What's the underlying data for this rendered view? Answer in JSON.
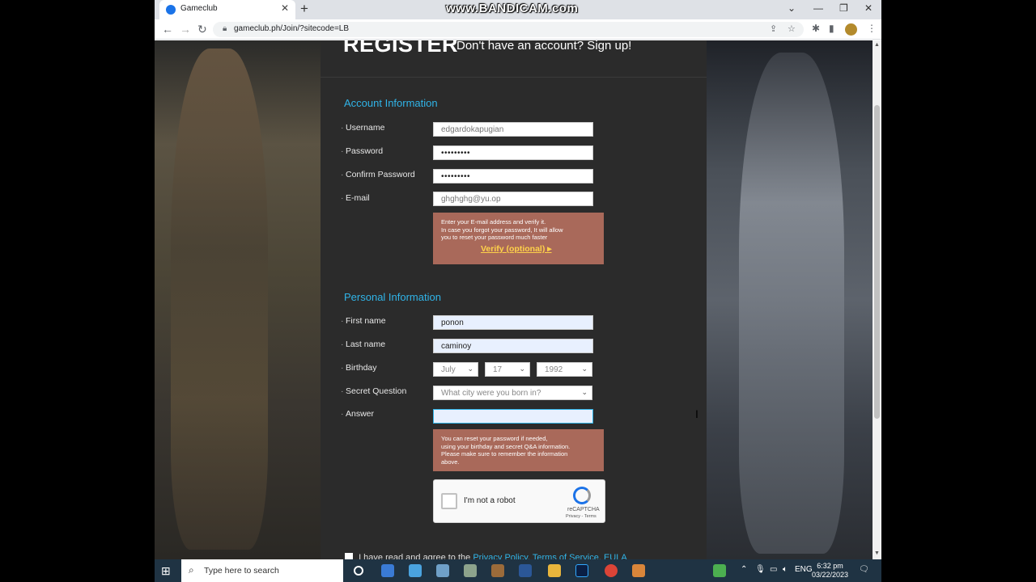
{
  "browser": {
    "tab_title": "Gameclub",
    "tab_close": "✕",
    "new_tab": "+",
    "url": "gameclub.ph/Join/?sitecode=LB",
    "watermark": "www.BANDICAM.com",
    "win_min": "⌄",
    "win_min2": "—",
    "win_restore": "❐",
    "win_close": "✕"
  },
  "page": {
    "title": "REGISTER",
    "subtitle": "Don't have an account? Sign up!",
    "account_section": "Account Information",
    "personal_section": "Personal Information",
    "fields": {
      "username_label": "Username",
      "username_value": "edgardokapugian",
      "password_label": "Password",
      "password_value": "•••••••••",
      "confirm_label": "Confirm Password",
      "confirm_value": "•••••••••",
      "email_label": "E-mail",
      "email_value": "ghghghg@yu.op",
      "firstname_label": "First name",
      "firstname_value": "ponon",
      "lastname_label": "Last name",
      "lastname_value": "caminoy",
      "birthday_label": "Birthday",
      "birth_month": "July",
      "birth_day": "17",
      "birth_year": "1992",
      "secret_label": "Secret Question",
      "secret_value": "What city were you born in?",
      "answer_label": "Answer"
    },
    "email_tip": {
      "line1": "Enter your E-mail address and verify it.",
      "line2": "In case you forgot your password, It will allow",
      "line3": "you to reset your password much faster",
      "verify": "Verify (optional) ▸"
    },
    "answer_tip": {
      "line1": "You can reset your password if needed,",
      "line2": "using your birthday and secret Q&A information.",
      "line3": "Please make sure to remember the information",
      "line4": "above."
    },
    "captcha": {
      "label": "I'm not a robot",
      "brand": "reCAPTCHA",
      "links": "Privacy - Terms"
    },
    "agree": {
      "prefix": "I have read and agree to the",
      "privacy": "Privacy Policy,",
      "terms": "Terms of Service,",
      "eula": "EULA"
    }
  },
  "taskbar": {
    "search_placeholder": "Type here to search",
    "lang": "ENG",
    "time": "6:32 pm",
    "date": "03/22/2023"
  }
}
